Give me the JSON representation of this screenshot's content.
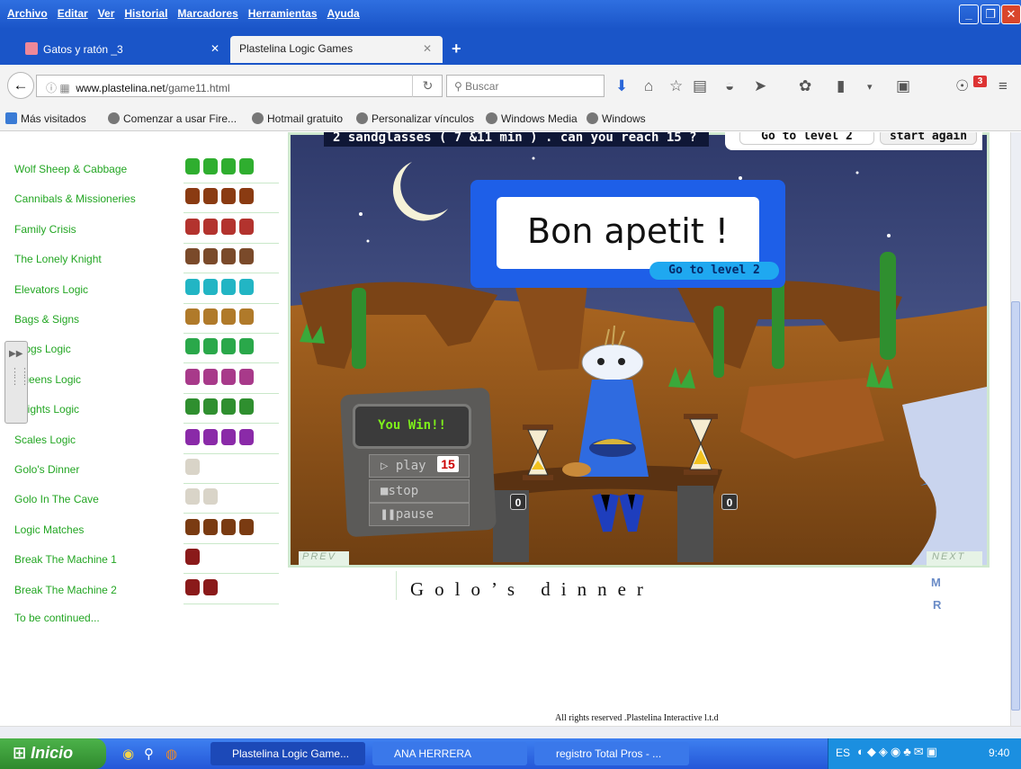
{
  "menu": [
    "Archivo",
    "Editar",
    "Ver",
    "Historial",
    "Marcadores",
    "Herramientas",
    "Ayuda"
  ],
  "tabs": [
    {
      "label": "Gatos y ratón _3"
    },
    {
      "label": "Plastelina Logic Games"
    }
  ],
  "nav": {
    "url_prefix": "www.plastelina.net",
    "url_path": "/game11.html",
    "search_placeholder": "Buscar",
    "notification_count": "3"
  },
  "bookmarks": [
    "Más visitados",
    "Comenzar a usar Fire...",
    "Hotmail gratuito",
    "Personalizar vínculos",
    "Windows Media",
    "Windows"
  ],
  "games": [
    "Wolf Sheep & Cabbage",
    "Cannibals & Missioneries",
    "Family Crisis",
    "The Lonely Knight",
    "Elevators Logic",
    "Bags & Signs",
    "Frogs Logic",
    "Queens Logic",
    "Knights Logic",
    "Scales Logic",
    "Golo's Dinner",
    "Golo In The Cave",
    "Logic Matches",
    "Break The Machine 1",
    "Break The Machine 2"
  ],
  "to_be_continued": "To be continued...",
  "game": {
    "prompt_prefix": "2 sandglasses ( 7 &11 min ) . can you reach",
    "target": "15",
    "prompt_suffix": "?",
    "goto_level_label": "Go to level 2",
    "start_again_label": "start again",
    "win_message": "Bon apetit !",
    "win_goto_level": "Go to level 2",
    "status": "You Win!!",
    "play_label": "play",
    "play_count": "15",
    "stop_label": "stop",
    "pause_label": "pause",
    "left_counter": "0",
    "right_counter": "0",
    "prev_label": "PREV",
    "next_label": "NEXT"
  },
  "page": {
    "title": "Golo’s dinner",
    "m_link": "M",
    "r_link": "R",
    "copyright": "All rights reserved .Plastelina Interactive l.t.d"
  },
  "taskbar": {
    "start": "Inicio",
    "items": [
      "Plastelina Logic Game...",
      "ANA HERRERA",
      "registro Total Pros - ..."
    ],
    "lang": "ES",
    "clock": "9:40"
  },
  "colors": {
    "accent_green": "#23a623",
    "xp_blue": "#1a55c8",
    "win_blue": "#1e5fe8",
    "sky": "#3a4778"
  }
}
